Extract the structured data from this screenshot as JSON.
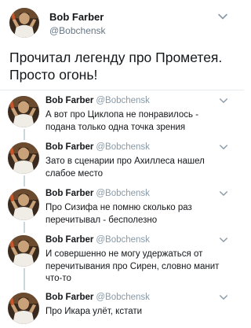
{
  "main_tweet": {
    "name": "Bob Farber",
    "handle": "@Bobchensk",
    "text_line1": "Прочитал легенду про Прометея.",
    "text_line2": "Просто огонь!"
  },
  "replies": [
    {
      "name": "Bob Farber",
      "handle": "@Bobchensk",
      "lines": [
        "А вот про Циклопа не понравилось -",
        "подана только одна точка зрения"
      ]
    },
    {
      "name": "Bob Farber",
      "handle": "@Bobchensk",
      "lines": [
        "Зато в сценарии про Ахиллеса нашел",
        "слабое место"
      ]
    },
    {
      "name": "Bob Farber",
      "handle": "@Bobchensk",
      "lines": [
        "Про Сизифа не помню сколько раз",
        "перечитывал - бесполезно"
      ]
    },
    {
      "name": "Bob Farber",
      "handle": "@Bobchensk",
      "lines": [
        "И совершенно не могу удержаться от",
        "перечитывания про Сирен, словно манит",
        "что-то"
      ]
    },
    {
      "name": "Bob Farber",
      "handle": "@Bobchensk",
      "lines": [
        "Про Икара улёт, кстати"
      ]
    }
  ],
  "icons": {
    "menu": "chevron-down-icon",
    "avatar": "avatar-photo"
  },
  "colors": {
    "text": "#14171a",
    "secondary": "#8899a6",
    "thread_line": "#ccd6dd"
  }
}
